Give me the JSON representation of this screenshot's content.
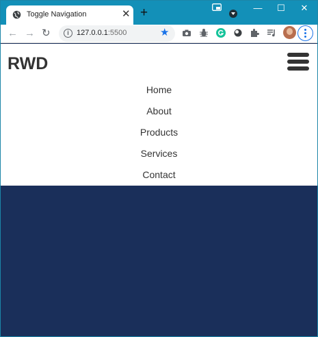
{
  "browser": {
    "tab_title": "Toggle Navigation",
    "tab_close_glyph": "✕",
    "new_tab_glyph": "+",
    "url_host": "127.0.0.1",
    "url_port": ":5500",
    "window_controls": {
      "minimize": "—",
      "maximize": "☐",
      "close": "✕"
    },
    "nav": {
      "back": "←",
      "forward": "→",
      "reload": "↻"
    },
    "info_glyph": "i",
    "star_glyph": "★",
    "extensions": [
      "camera-icon",
      "bug-icon",
      "grammarly-icon",
      "circle-icon",
      "puzzle-icon",
      "media-queue-icon"
    ],
    "accent_color": "#1390b8"
  },
  "site": {
    "logo": "RWD",
    "nav_items": [
      "Home",
      "About",
      "Products",
      "Services",
      "Contact"
    ],
    "text_color": "#333333",
    "body_color": "#1a2f5a"
  }
}
